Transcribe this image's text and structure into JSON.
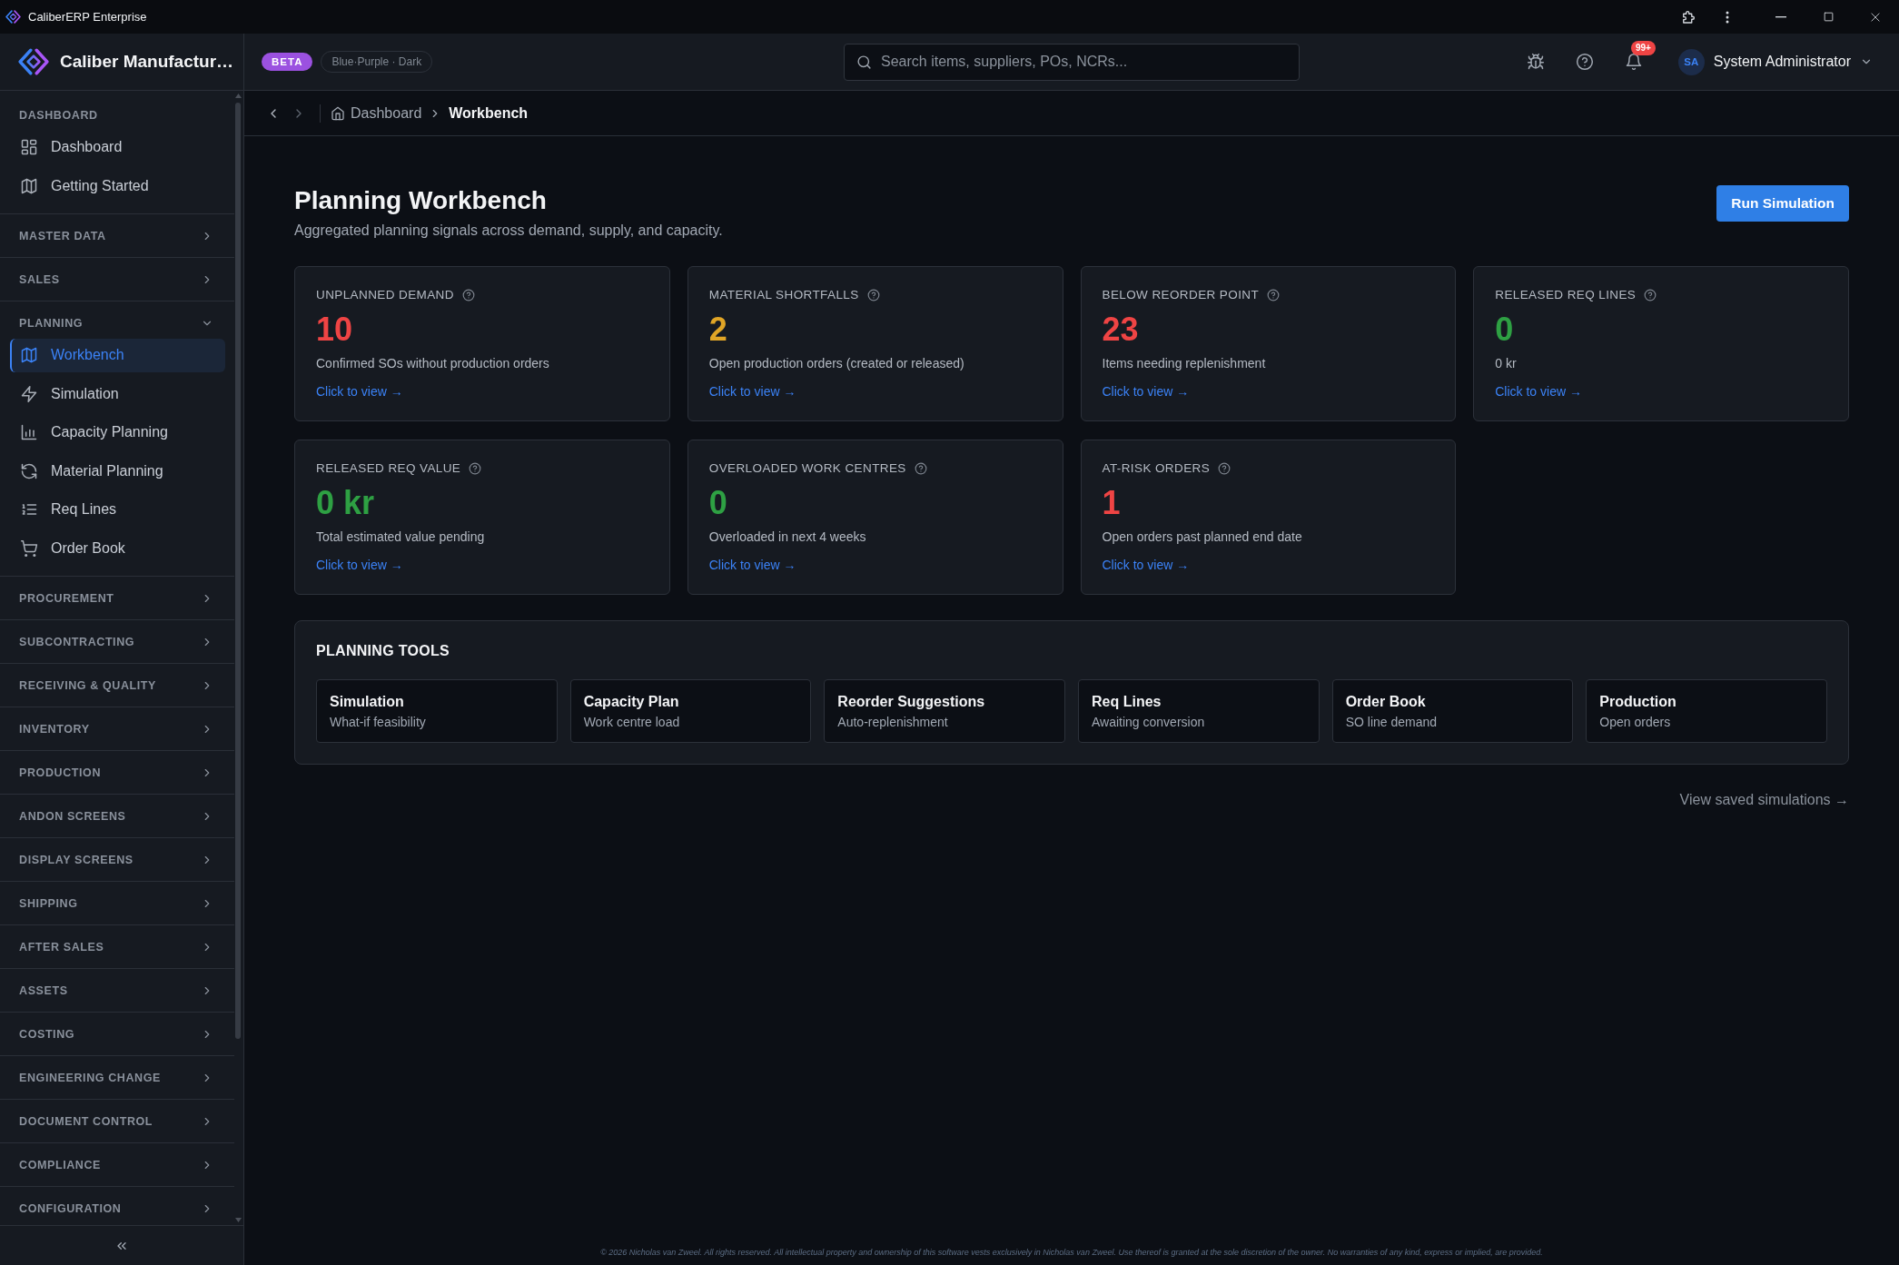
{
  "window": {
    "title": "CaliberERP Enterprise"
  },
  "sidebar": {
    "brand": "Caliber Manufactur…",
    "sections": [
      {
        "title": "DASHBOARD",
        "kind": "static",
        "items": [
          {
            "label": "Dashboard",
            "selected": false
          },
          {
            "label": "Getting Started",
            "selected": false
          }
        ]
      },
      {
        "title": "MASTER DATA",
        "kind": "group",
        "expanded": false
      },
      {
        "title": "SALES",
        "kind": "group",
        "expanded": false
      },
      {
        "title": "PLANNING",
        "kind": "group",
        "expanded": true,
        "items": [
          {
            "label": "Workbench",
            "selected": true
          },
          {
            "label": "Simulation",
            "selected": false
          },
          {
            "label": "Capacity Planning",
            "selected": false
          },
          {
            "label": "Material Planning",
            "selected": false
          },
          {
            "label": "Req Lines",
            "selected": false
          },
          {
            "label": "Order Book",
            "selected": false
          }
        ]
      },
      {
        "title": "PROCUREMENT",
        "kind": "group",
        "expanded": false
      },
      {
        "title": "SUBCONTRACTING",
        "kind": "group",
        "expanded": false
      },
      {
        "title": "RECEIVING & QUALITY",
        "kind": "group",
        "expanded": false
      },
      {
        "title": "INVENTORY",
        "kind": "group",
        "expanded": false
      },
      {
        "title": "PRODUCTION",
        "kind": "group",
        "expanded": false
      },
      {
        "title": "ANDON SCREENS",
        "kind": "group",
        "expanded": false
      },
      {
        "title": "DISPLAY SCREENS",
        "kind": "group",
        "expanded": false
      },
      {
        "title": "SHIPPING",
        "kind": "group",
        "expanded": false
      },
      {
        "title": "AFTER SALES",
        "kind": "group",
        "expanded": false
      },
      {
        "title": "ASSETS",
        "kind": "group",
        "expanded": false
      },
      {
        "title": "COSTING",
        "kind": "group",
        "expanded": false
      },
      {
        "title": "ENGINEERING CHANGE",
        "kind": "group",
        "expanded": false
      },
      {
        "title": "DOCUMENT CONTROL",
        "kind": "group",
        "expanded": false
      },
      {
        "title": "COMPLIANCE",
        "kind": "group",
        "expanded": false
      },
      {
        "title": "CONFIGURATION",
        "kind": "group",
        "expanded": false
      }
    ]
  },
  "header": {
    "badge": "BETA",
    "theme": "Blue·Purple · Dark",
    "search": {
      "placeholder": "Search items, suppliers, POs, NCRs..."
    },
    "notifications": "99+",
    "user": {
      "initials": "SA",
      "name": "System Administrator"
    }
  },
  "breadcrumb": {
    "nav_buttons": [
      {
        "kind": "back",
        "disabled": false
      },
      {
        "kind": "forward",
        "disabled": true
      }
    ],
    "items": [
      {
        "label": "Dashboard",
        "current": false
      },
      {
        "label": "Workbench",
        "current": true
      }
    ]
  },
  "page": {
    "title": "Planning Workbench",
    "subtitle": "Aggregated planning signals across demand, supply, and capacity.",
    "action": "Run Simulation"
  },
  "cards": [
    {
      "label": "UNPLANNED DEMAND",
      "value": "10",
      "color": "#ef4444",
      "description": "Confirmed SOs without production orders",
      "link": "Click to view →"
    },
    {
      "label": "MATERIAL SHORTFALLS",
      "value": "2",
      "color": "#e0a526",
      "description": "Open production orders (created or released)",
      "link": "Click to view →"
    },
    {
      "label": "BELOW REORDER POINT",
      "value": "23",
      "color": "#ef4444",
      "description": "Items needing replenishment",
      "link": "Click to view →"
    },
    {
      "label": "RELEASED REQ LINES",
      "value": "0",
      "color": "#2ea043",
      "description": "0 kr",
      "link": "Click to view →"
    },
    {
      "label": "RELEASED REQ VALUE",
      "value": "0 kr",
      "color": "#2ea043",
      "description": "Total estimated value pending",
      "link": "Click to view →"
    },
    {
      "label": "OVERLOADED WORK CENTRES",
      "value": "0",
      "color": "#2ea043",
      "description": "Overloaded in next 4 weeks",
      "link": "Click to view →"
    },
    {
      "label": "AT-RISK ORDERS",
      "value": "1",
      "color": "#ef4444",
      "description": "Open orders past planned end date",
      "link": "Click to view →"
    }
  ],
  "tools": {
    "title": "PLANNING TOOLS",
    "items": [
      {
        "title": "Simulation",
        "subtitle": "What-if feasibility"
      },
      {
        "title": "Capacity Plan",
        "subtitle": "Work centre load"
      },
      {
        "title": "Reorder Suggestions",
        "subtitle": "Auto-replenishment"
      },
      {
        "title": "Req Lines",
        "subtitle": "Awaiting conversion"
      },
      {
        "title": "Order Book",
        "subtitle": "SO line demand"
      },
      {
        "title": "Production",
        "subtitle": "Open orders"
      }
    ]
  },
  "saved_link": "View saved simulations →",
  "footer": "© 2026 Nicholas van Zweel. All rights reserved. All intellectual property and ownership of this software vests exclusively in Nicholas van Zweel. Use thereof is granted at the sole discretion of the owner. No warranties of any kind, express or implied, are provided."
}
